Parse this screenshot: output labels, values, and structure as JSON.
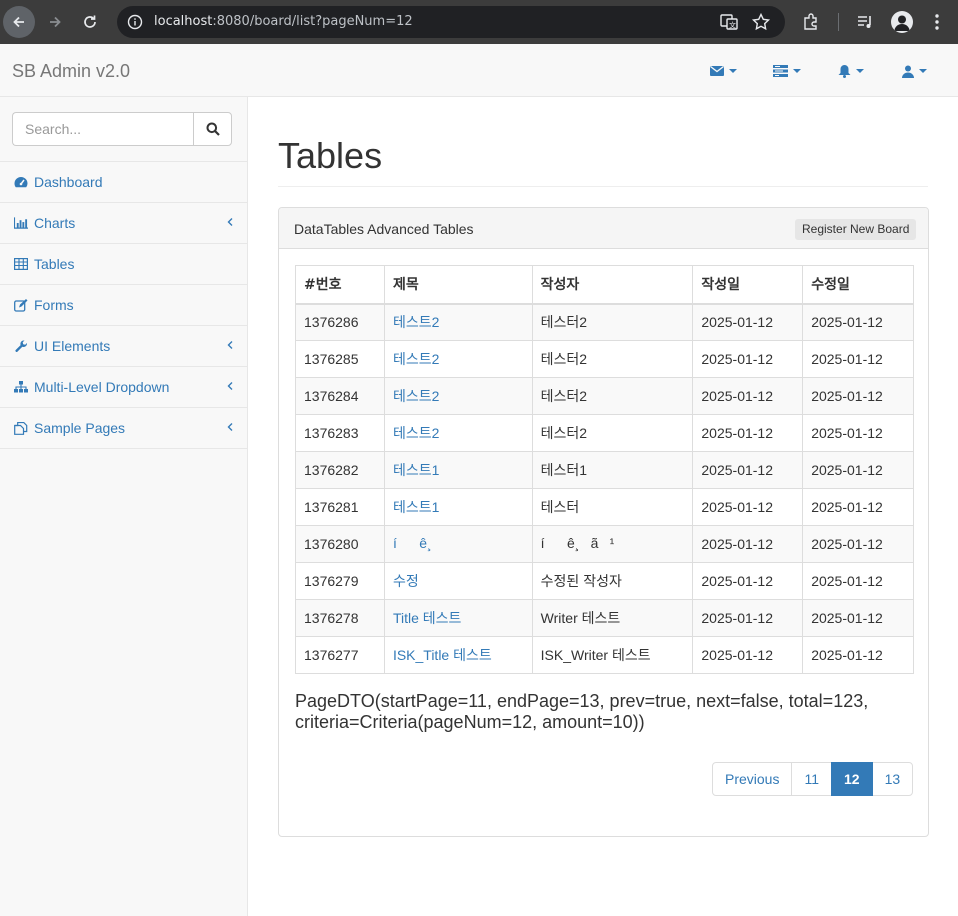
{
  "browser": {
    "url_host": "localhost",
    "url_rest": ":8080/board/list?pageNum=12"
  },
  "navbar": {
    "brand": "SB Admin v2.0"
  },
  "sidebar": {
    "search_placeholder": "Search...",
    "items": [
      {
        "label": "Dashboard",
        "icon": "dashboard-icon",
        "has_submenu": false
      },
      {
        "label": "Charts",
        "icon": "bar-chart-icon",
        "has_submenu": true
      },
      {
        "label": "Tables",
        "icon": "table-icon",
        "has_submenu": false
      },
      {
        "label": "Forms",
        "icon": "edit-icon",
        "has_submenu": false
      },
      {
        "label": "UI Elements",
        "icon": "wrench-icon",
        "has_submenu": true
      },
      {
        "label": "Multi-Level Dropdown",
        "icon": "sitemap-icon",
        "has_submenu": true
      },
      {
        "label": "Sample Pages",
        "icon": "files-icon",
        "has_submenu": true
      }
    ]
  },
  "main": {
    "title": "Tables",
    "panel_title": "DataTables Advanced Tables",
    "register_button": "Register New Board",
    "table": {
      "headers": [
        "#번호",
        "제목",
        "작성자",
        "작성일",
        "수정일"
      ],
      "rows": [
        {
          "no": "1376286",
          "title": "테스트2",
          "writer": "테스터2",
          "regdate": "2025-01-12",
          "updatedate": "2025-01-12"
        },
        {
          "no": "1376285",
          "title": "테스트2",
          "writer": "테스터2",
          "regdate": "2025-01-12",
          "updatedate": "2025-01-12"
        },
        {
          "no": "1376284",
          "title": "테스트2",
          "writer": "테스터2",
          "regdate": "2025-01-12",
          "updatedate": "2025-01-12"
        },
        {
          "no": "1376283",
          "title": "테스트2",
          "writer": "테스터2",
          "regdate": "2025-01-12",
          "updatedate": "2025-01-12"
        },
        {
          "no": "1376282",
          "title": "테스트1",
          "writer": "테스터1",
          "regdate": "2025-01-12",
          "updatedate": "2025-01-12"
        },
        {
          "no": "1376281",
          "title": "테스트1",
          "writer": "테스터",
          "regdate": "2025-01-12",
          "updatedate": "2025-01-12"
        },
        {
          "no": "1376280",
          "title": "íê¸",
          "writer": "íê¸ã¹",
          "regdate": "2025-01-12",
          "updatedate": "2025-01-12"
        },
        {
          "no": "1376279",
          "title": "수정",
          "writer": "수정된 작성자",
          "regdate": "2025-01-12",
          "updatedate": "2025-01-12"
        },
        {
          "no": "1376278",
          "title": "Title 테스트",
          "writer": "Writer 테스트",
          "regdate": "2025-01-12",
          "updatedate": "2025-01-12"
        },
        {
          "no": "1376277",
          "title": "ISK_Title 테스트",
          "writer": "ISK_Writer 테스트",
          "regdate": "2025-01-12",
          "updatedate": "2025-01-12"
        }
      ]
    },
    "pagedto_text": "PageDTO(startPage=11, endPage=13, prev=true, next=false, total=123, criteria=Criteria(pageNum=12, amount=10))",
    "pagination": {
      "previous": "Previous",
      "pages": [
        "11",
        "12",
        "13"
      ],
      "active": "12"
    }
  },
  "colors": {
    "link": "#337ab7",
    "chrome_bg": "#3c3c3c",
    "navbar_bg": "#f8f8f8"
  }
}
